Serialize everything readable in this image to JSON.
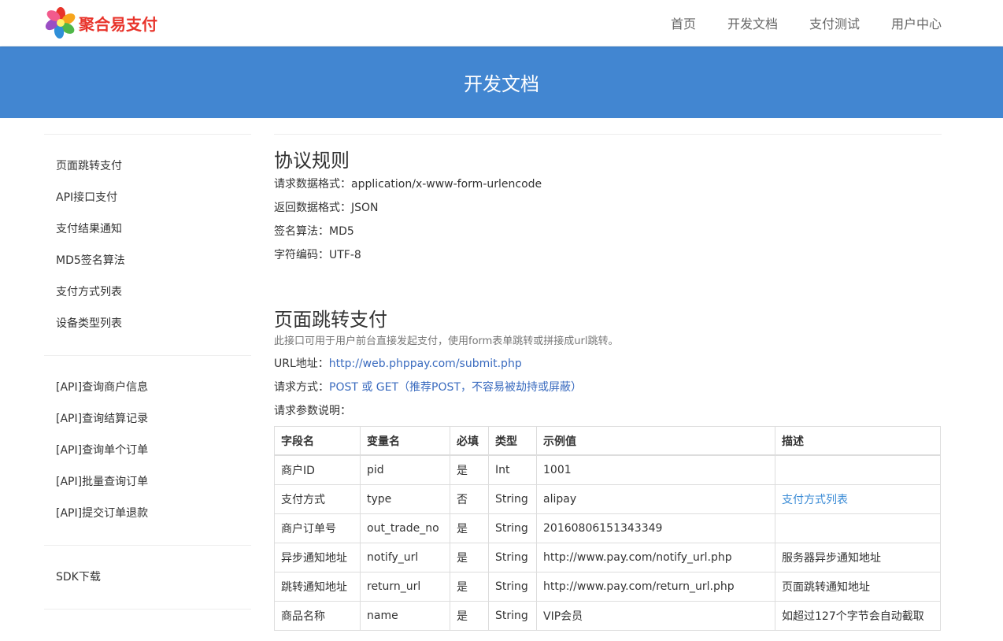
{
  "brand": {
    "name": "聚合易支付"
  },
  "nav": {
    "items": [
      "首页",
      "开发文档",
      "支付测试",
      "用户中心"
    ]
  },
  "banner": {
    "title": "开发文档"
  },
  "sidebar": {
    "group1": [
      "页面跳转支付",
      "API接口支付",
      "支付结果通知",
      "MD5签名算法",
      "支付方式列表",
      "设备类型列表"
    ],
    "group2": [
      "[API]查询商户信息",
      "[API]查询结算记录",
      "[API]查询单个订单",
      "[API]批量查询订单",
      "[API]提交订单退款"
    ],
    "group3": [
      "SDK下载"
    ]
  },
  "protocol": {
    "title": "协议规则",
    "lines": [
      "请求数据格式：application/x-www-form-urlencode",
      "返回数据格式：JSON",
      "签名算法：MD5",
      "字符编码：UTF-8"
    ]
  },
  "redirect": {
    "title": "页面跳转支付",
    "desc": "此接口可用于用户前台直接发起支付，使用form表单跳转或拼接成url跳转。",
    "url_label": "URL地址：",
    "url": "http://web.phppay.com/submit.php",
    "method_label": "请求方式：",
    "method": "POST 或 GET（推荐POST，不容易被劫持或屏蔽）",
    "params_label": "请求参数说明："
  },
  "table": {
    "headers": [
      "字段名",
      "变量名",
      "必填",
      "类型",
      "示例值",
      "描述"
    ],
    "rows": [
      [
        "商户ID",
        "pid",
        "是",
        "Int",
        "1001",
        ""
      ],
      [
        "支付方式",
        "type",
        "否",
        "String",
        "alipay",
        "支付方式列表"
      ],
      [
        "商户订单号",
        "out_trade_no",
        "是",
        "String",
        "20160806151343349",
        ""
      ],
      [
        "异步通知地址",
        "notify_url",
        "是",
        "String",
        "http://www.pay.com/notify_url.php",
        "服务器异步通知地址"
      ],
      [
        "跳转通知地址",
        "return_url",
        "是",
        "String",
        "http://www.pay.com/return_url.php",
        "页面跳转通知地址"
      ],
      [
        "商品名称",
        "name",
        "是",
        "String",
        "VIP会员",
        "如超过127个字节会自动截取"
      ]
    ]
  },
  "colors": {
    "banner": "#4286d1",
    "link": "#3a6bbf",
    "brand_text": "#e8332a"
  }
}
